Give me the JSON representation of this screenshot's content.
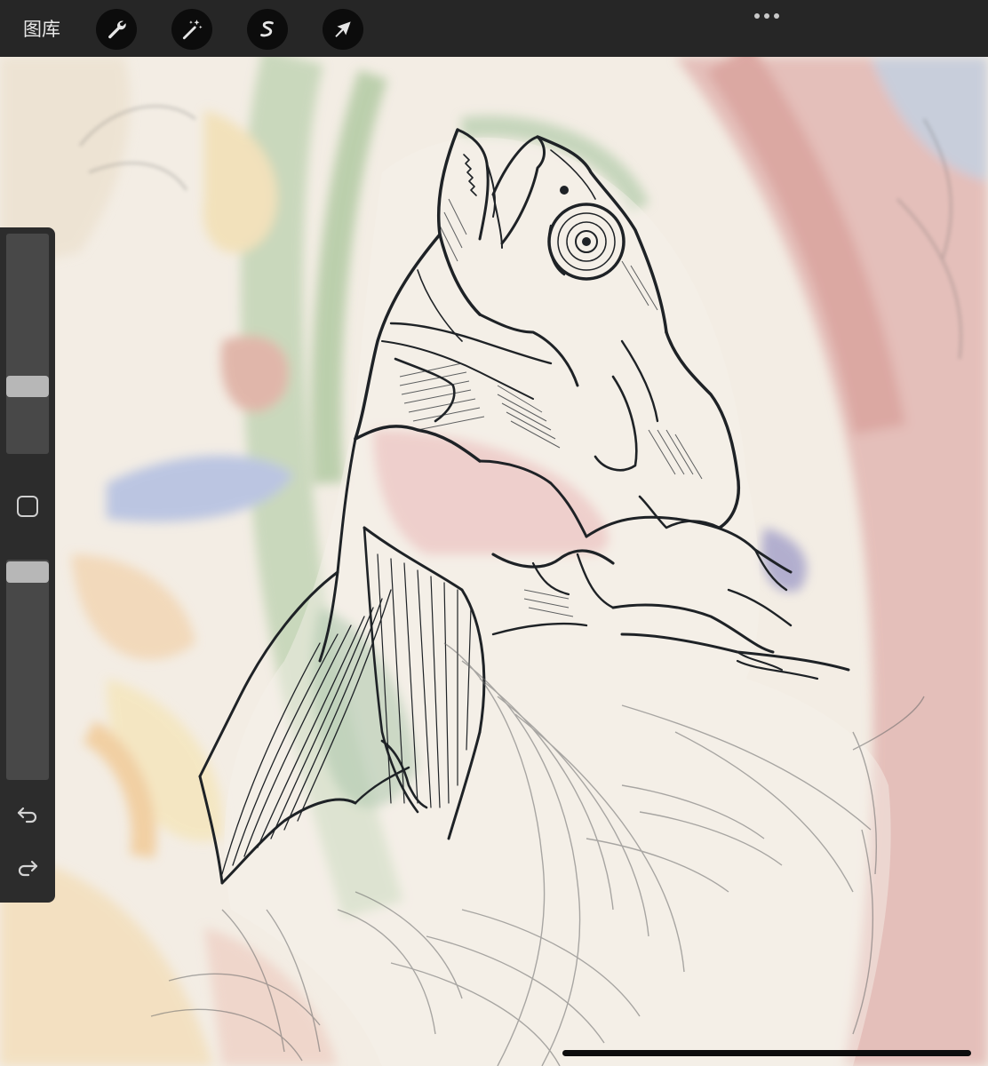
{
  "topbar": {
    "gallery_label": "图库",
    "tools": [
      {
        "name": "actions",
        "icon": "wrench-icon"
      },
      {
        "name": "adjustments",
        "icon": "magic-wand-icon"
      },
      {
        "name": "selection",
        "icon": "selection-s-icon"
      },
      {
        "name": "transform",
        "icon": "arrow-cursor-icon"
      }
    ],
    "more_icon": "ellipsis-icon"
  },
  "sidebar": {
    "brush_size_slider": {
      "icon": "slider-thumb",
      "level": 0.35
    },
    "modify_button_icon": "square-icon",
    "opacity_slider": {
      "icon": "slider-thumb",
      "level": 0.95
    },
    "undo_icon": "undo-icon",
    "redo_icon": "redo-icon"
  },
  "canvas": {
    "artwork_subject": "fish-skull-sketch-icon"
  },
  "colors": {
    "toolbar_bg": "#262626",
    "tool_button_bg": "#0c0c0c",
    "sidebar_bg": "#2c2c2c",
    "canvas_bg": "#f3ede4",
    "ink": "#1e2226"
  }
}
